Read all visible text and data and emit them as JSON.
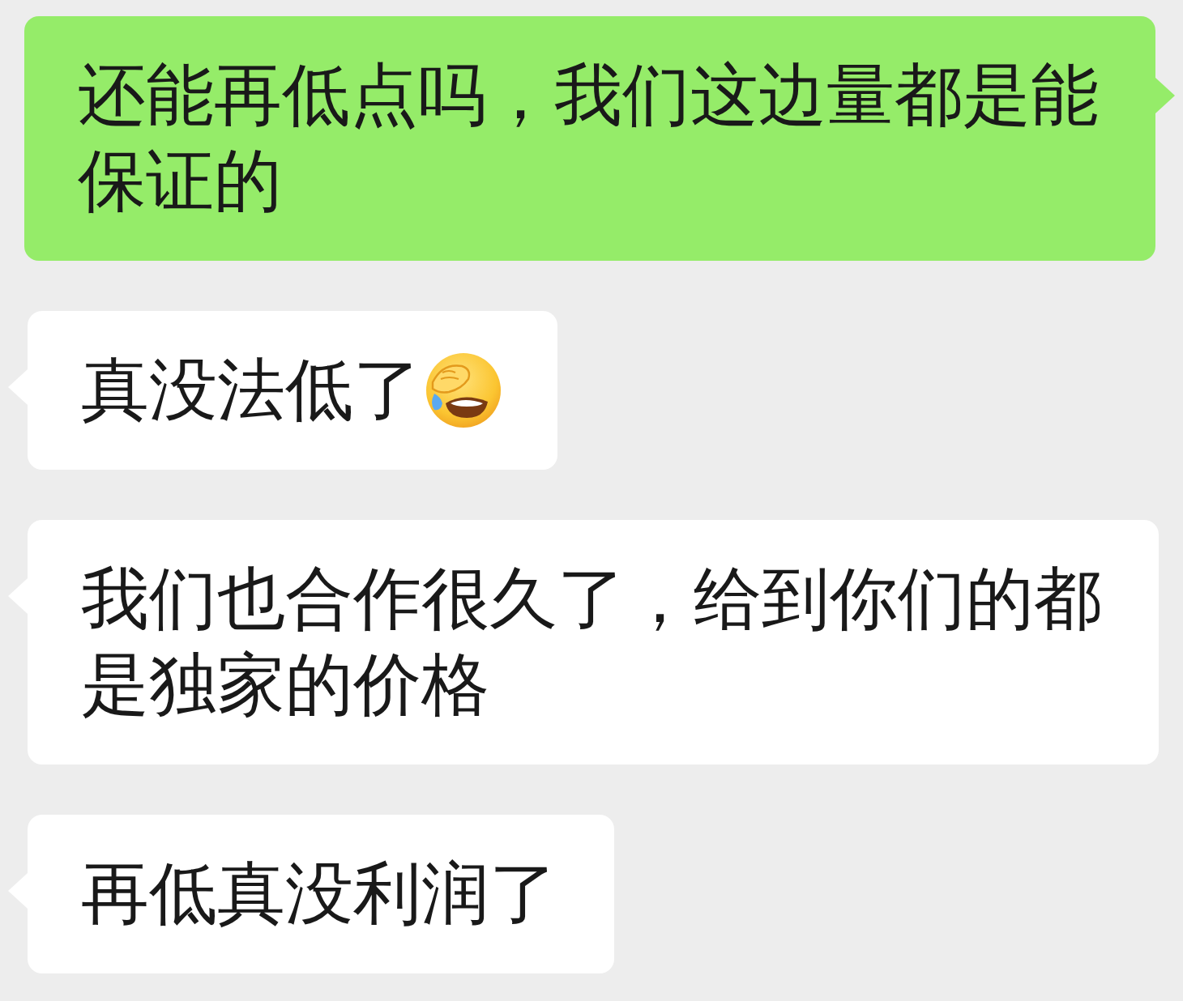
{
  "messages": [
    {
      "outgoing": true,
      "text": "还能再低点吗，我们这边量都是能保证的",
      "emoji": false
    },
    {
      "outgoing": false,
      "text": "真没法低了",
      "emoji": true
    },
    {
      "outgoing": false,
      "text": "我们也合作很久了，给到你们的都是独家的价格",
      "emoji": false
    },
    {
      "outgoing": false,
      "text": "再低真没利润了",
      "emoji": false
    }
  ]
}
